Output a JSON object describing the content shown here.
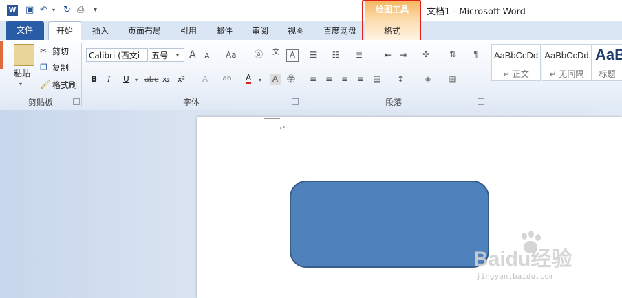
{
  "title_bar": {
    "doc_title": "文档1 - Microsoft Word"
  },
  "contextual_group": {
    "label": "绘图工具",
    "tab": "格式"
  },
  "tabs": [
    "文件",
    "开始",
    "插入",
    "页面布局",
    "引用",
    "邮件",
    "审阅",
    "视图",
    "百度网盘"
  ],
  "clipboard": {
    "paste": "粘贴",
    "cut": "剪切",
    "copy": "复制",
    "format_painter": "格式刷",
    "group_label": "剪贴板"
  },
  "font": {
    "font_name": "Calibri (西文i",
    "font_size": "五号",
    "bold": "B",
    "italic": "I",
    "underline": "U",
    "strike": "abe",
    "subscript": "x₂",
    "superscript": "x²",
    "case": "Aa",
    "grow": "A",
    "shrink": "A",
    "color_a": "A",
    "group_label": "字体"
  },
  "paragraph": {
    "group_label": "段落"
  },
  "styles": {
    "items": [
      {
        "sample": "AaBbCcDd",
        "name": "↵ 正文"
      },
      {
        "sample": "AaBbCcDd",
        "name": "↵ 无间隔"
      },
      {
        "sample": "AaB",
        "name": "标题"
      }
    ]
  },
  "document": {
    "paragraph_mark": "↵"
  },
  "watermark": {
    "main": "Baidu经验",
    "sub": "jingyan.baidu.com"
  },
  "colors": {
    "shape_fill": "#4f81bd",
    "shape_border": "#385d8a",
    "file_tab": "#2a5ba6",
    "highlight": "#e0201c"
  }
}
